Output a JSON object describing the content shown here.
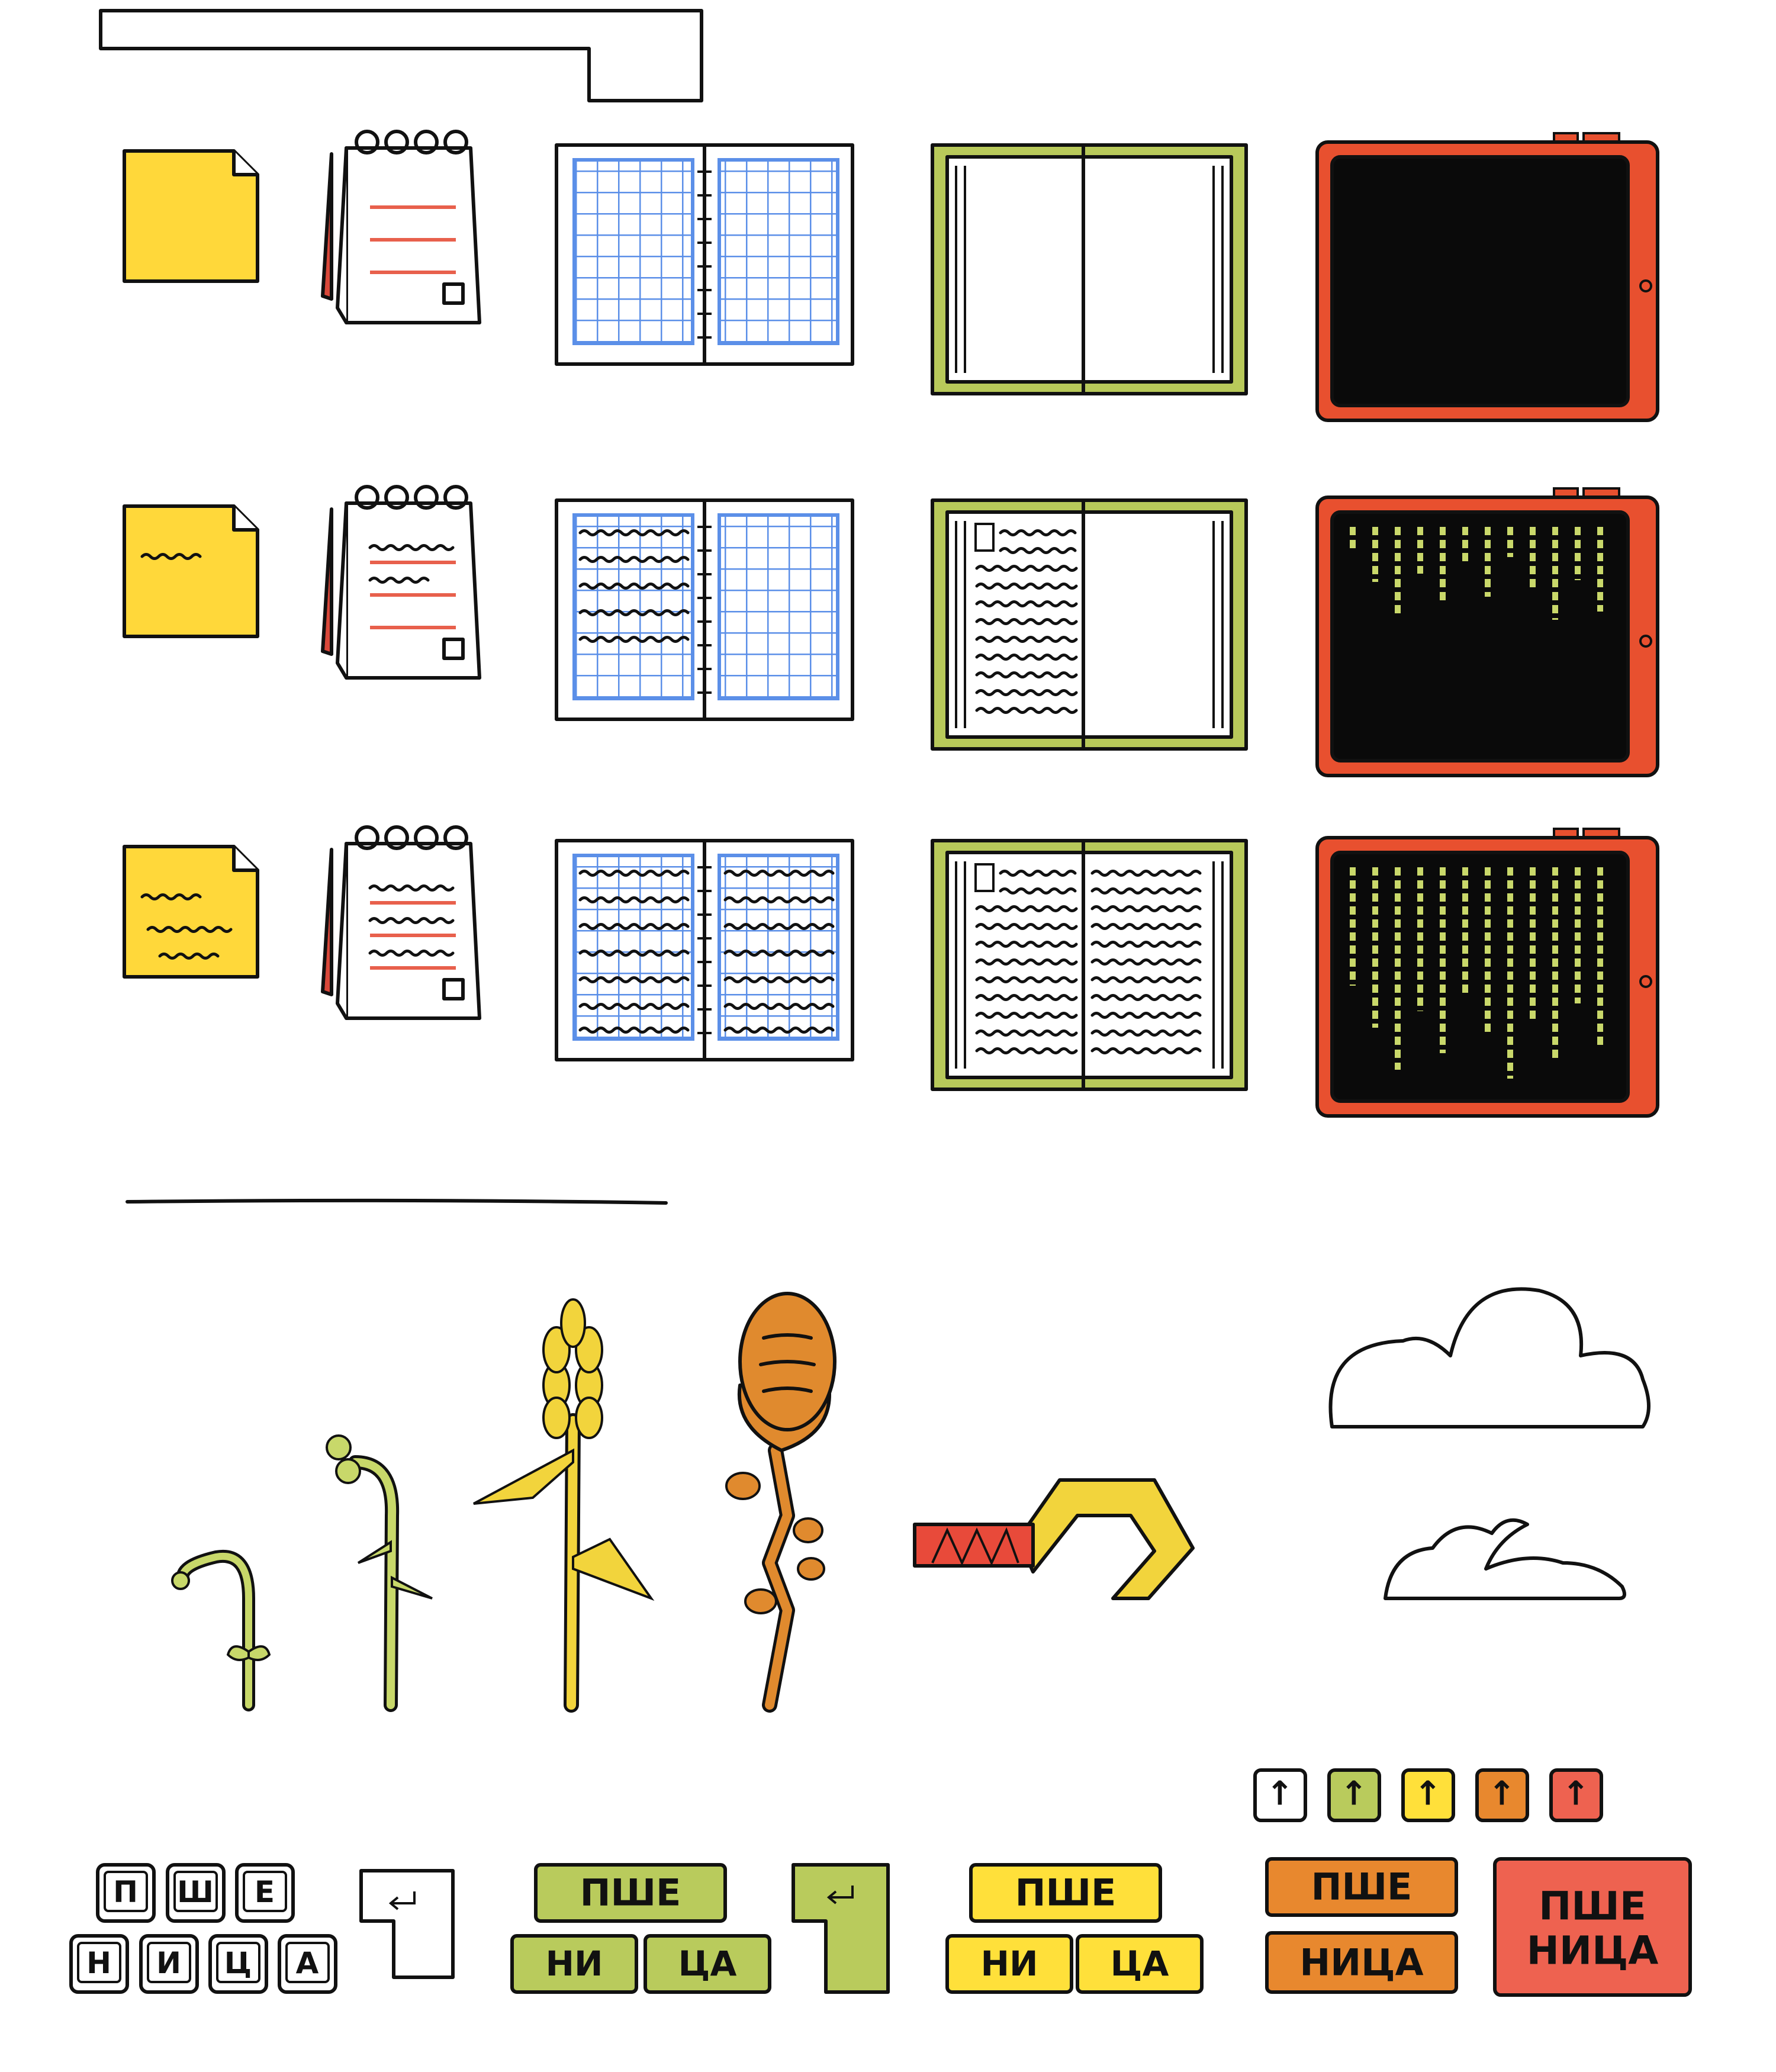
{
  "colors": {
    "ink": "#111111",
    "sticky": "#FFD83A",
    "notepad_line": "#E8604C",
    "notepad_spine": "#D9483A",
    "grid_blue": "#5B8FE8",
    "book_green": "#B8C95A",
    "tablet_red": "#E8502F",
    "screen_black": "#0A0A0A",
    "code_yellow": "#C9D86A",
    "sprout_green": "#C8D86A",
    "wheat_yellow": "#F2D43C",
    "bread_orange": "#E08A2E",
    "hook_red": "#E84A3A",
    "key_white": "#FFFFFF",
    "key_green": "#B9CB5C",
    "key_yellow": "#FFE03A",
    "key_orange": "#E8882E",
    "key_red": "#EE6250"
  },
  "sections": {
    "notes_progression": {
      "columns": [
        "sticky-note",
        "notepad",
        "grid-notebook",
        "book",
        "tablet"
      ],
      "stages": [
        "empty",
        "partial",
        "full"
      ]
    },
    "growth_progression": {
      "items": [
        "sprout-small",
        "sprout-medium",
        "wheat-stalk",
        "bread-stalk",
        "sickle",
        "cloud-large",
        "cloud-small"
      ]
    }
  },
  "arrow_keys": {
    "glyph": "↑",
    "colors": [
      "key_white",
      "key_green",
      "key_yellow",
      "key_orange",
      "key_red"
    ]
  },
  "keyboard_words": {
    "white_keys": [
      "П",
      "Ш",
      "Е",
      "Н",
      "И",
      "Ц",
      "А"
    ],
    "green_top": "ПШЕ",
    "green_bottom": [
      "НИ",
      "ЦА"
    ],
    "yellow_top": "ПШЕ",
    "yellow_bottom": [
      "НИ",
      "ЦА"
    ],
    "orange_top": "ПШЕ",
    "orange_bottom": "НИЦА",
    "red_line1": "ПШЕ",
    "red_line2": "НИЦА"
  }
}
